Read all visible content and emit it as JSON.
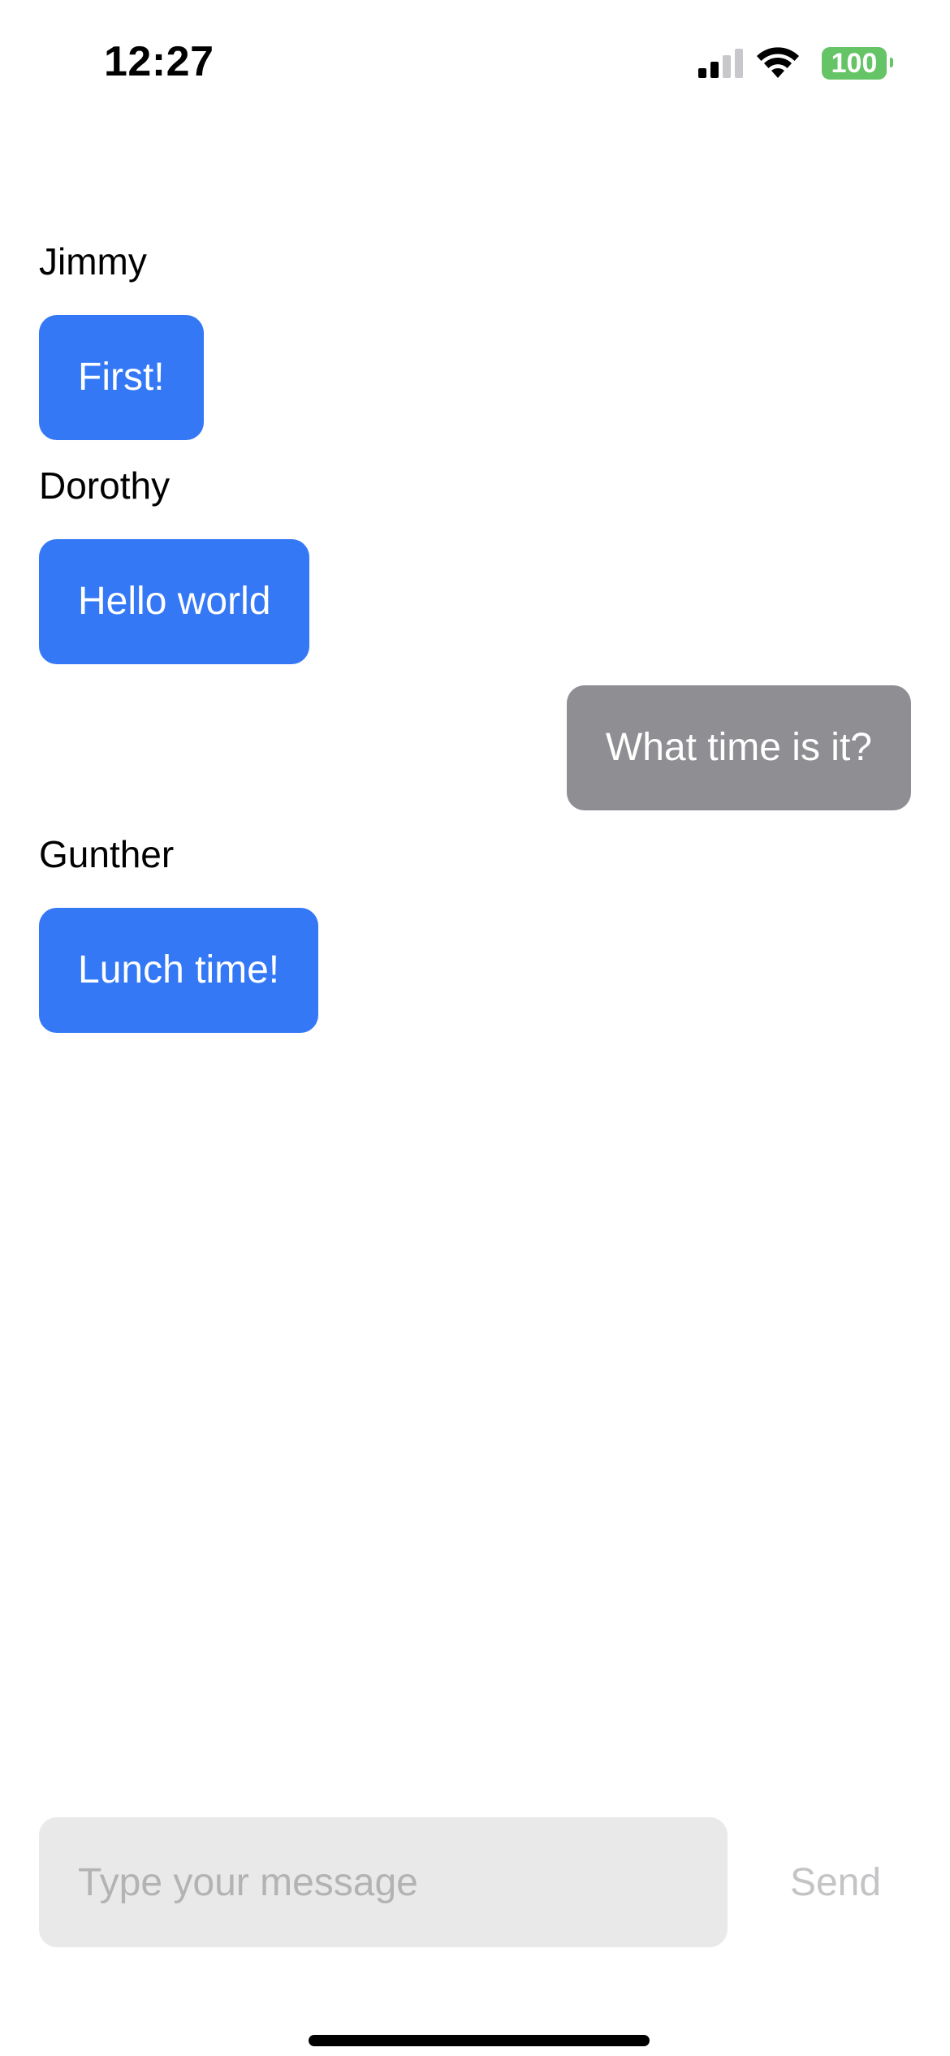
{
  "status_bar": {
    "time": "12:27",
    "battery_level": "100",
    "battery_color": "#65c466",
    "signal_icon": "cellular-signal-icon",
    "wifi_icon": "wifi-icon"
  },
  "chat": {
    "messages": [
      {
        "sender": "Jimmy",
        "text": "First!",
        "direction": "incoming"
      },
      {
        "sender": "Dorothy",
        "text": "Hello world",
        "direction": "incoming"
      },
      {
        "sender": "",
        "text": "What time is it?",
        "direction": "outgoing"
      },
      {
        "sender": "Gunther",
        "text": "Lunch time!",
        "direction": "incoming"
      }
    ],
    "incoming_color": "#3478f6",
    "outgoing_color": "#8e8e93"
  },
  "composer": {
    "placeholder": "Type your message",
    "value": "",
    "send_label": "Send"
  }
}
